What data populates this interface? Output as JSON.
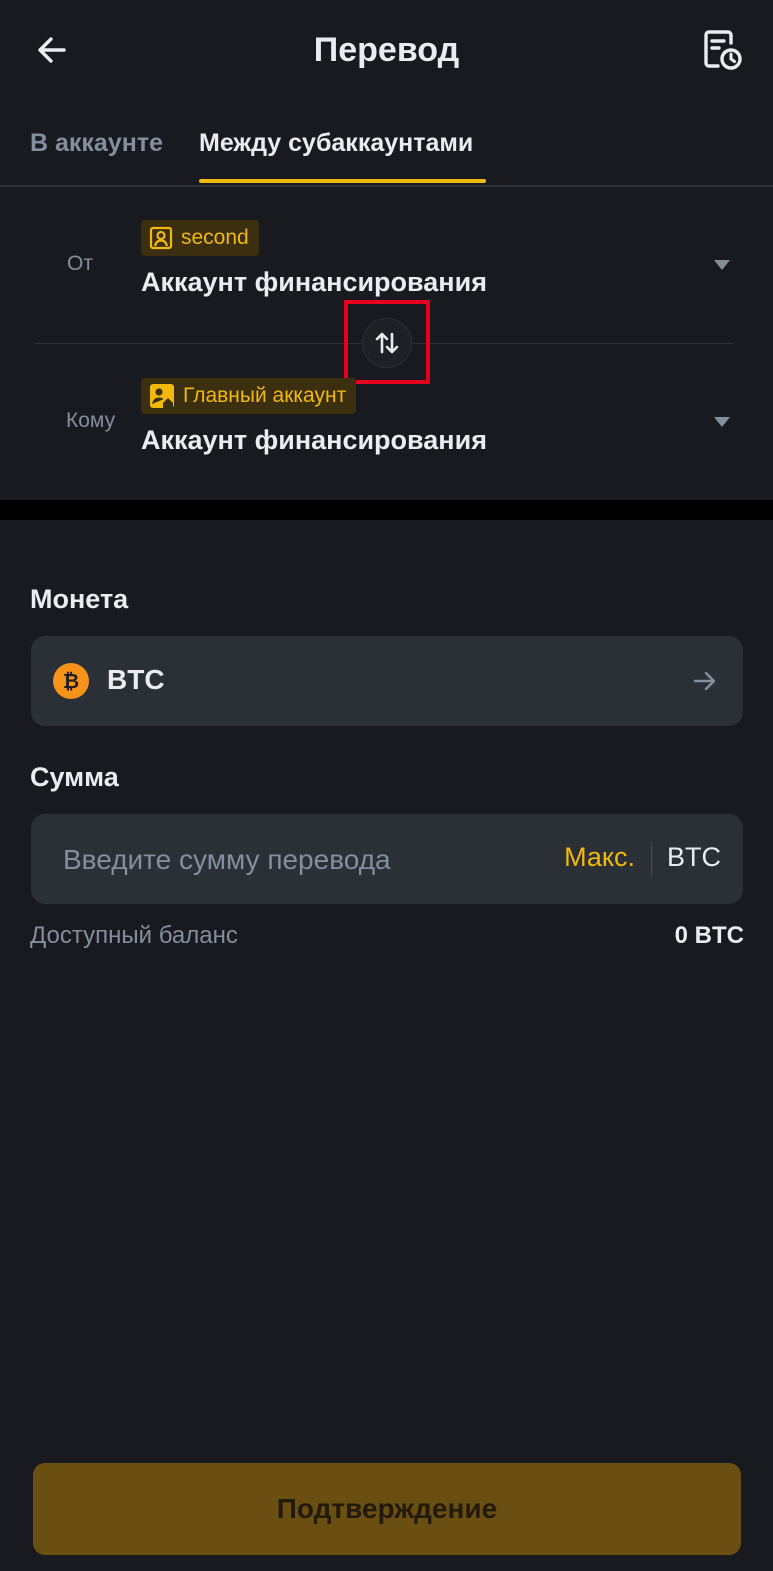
{
  "header": {
    "title": "Перевод",
    "back_icon": "arrow-left-icon",
    "history_icon": "history-icon"
  },
  "tabs": [
    {
      "label": "В аккаунте",
      "active": false
    },
    {
      "label": "Между субаккаунтами",
      "active": true
    }
  ],
  "transfer": {
    "from": {
      "label": "От",
      "tag": "second",
      "tag_icon": "user-icon",
      "account": "Аккаунт финансирования"
    },
    "to": {
      "label": "Кому",
      "tag": "Главный аккаунт",
      "tag_icon": "main-account-icon",
      "account": "Аккаунт финансирования"
    },
    "swap_icon": "swap-icon"
  },
  "coin": {
    "label": "Монета",
    "symbol": "BTC",
    "icon": "bitcoin-icon",
    "icon_glyph": "₿"
  },
  "amount": {
    "label": "Сумма",
    "placeholder": "Введите сумму перевода",
    "max_label": "Макс.",
    "unit": "BTC"
  },
  "balance": {
    "label": "Доступный баланс",
    "value": "0 BTC"
  },
  "confirm_label": "Подтверждение",
  "colors": {
    "background": "#181A20",
    "accent": "#F0B90B",
    "field": "#2B2F36",
    "highlight": "#E6001E"
  }
}
